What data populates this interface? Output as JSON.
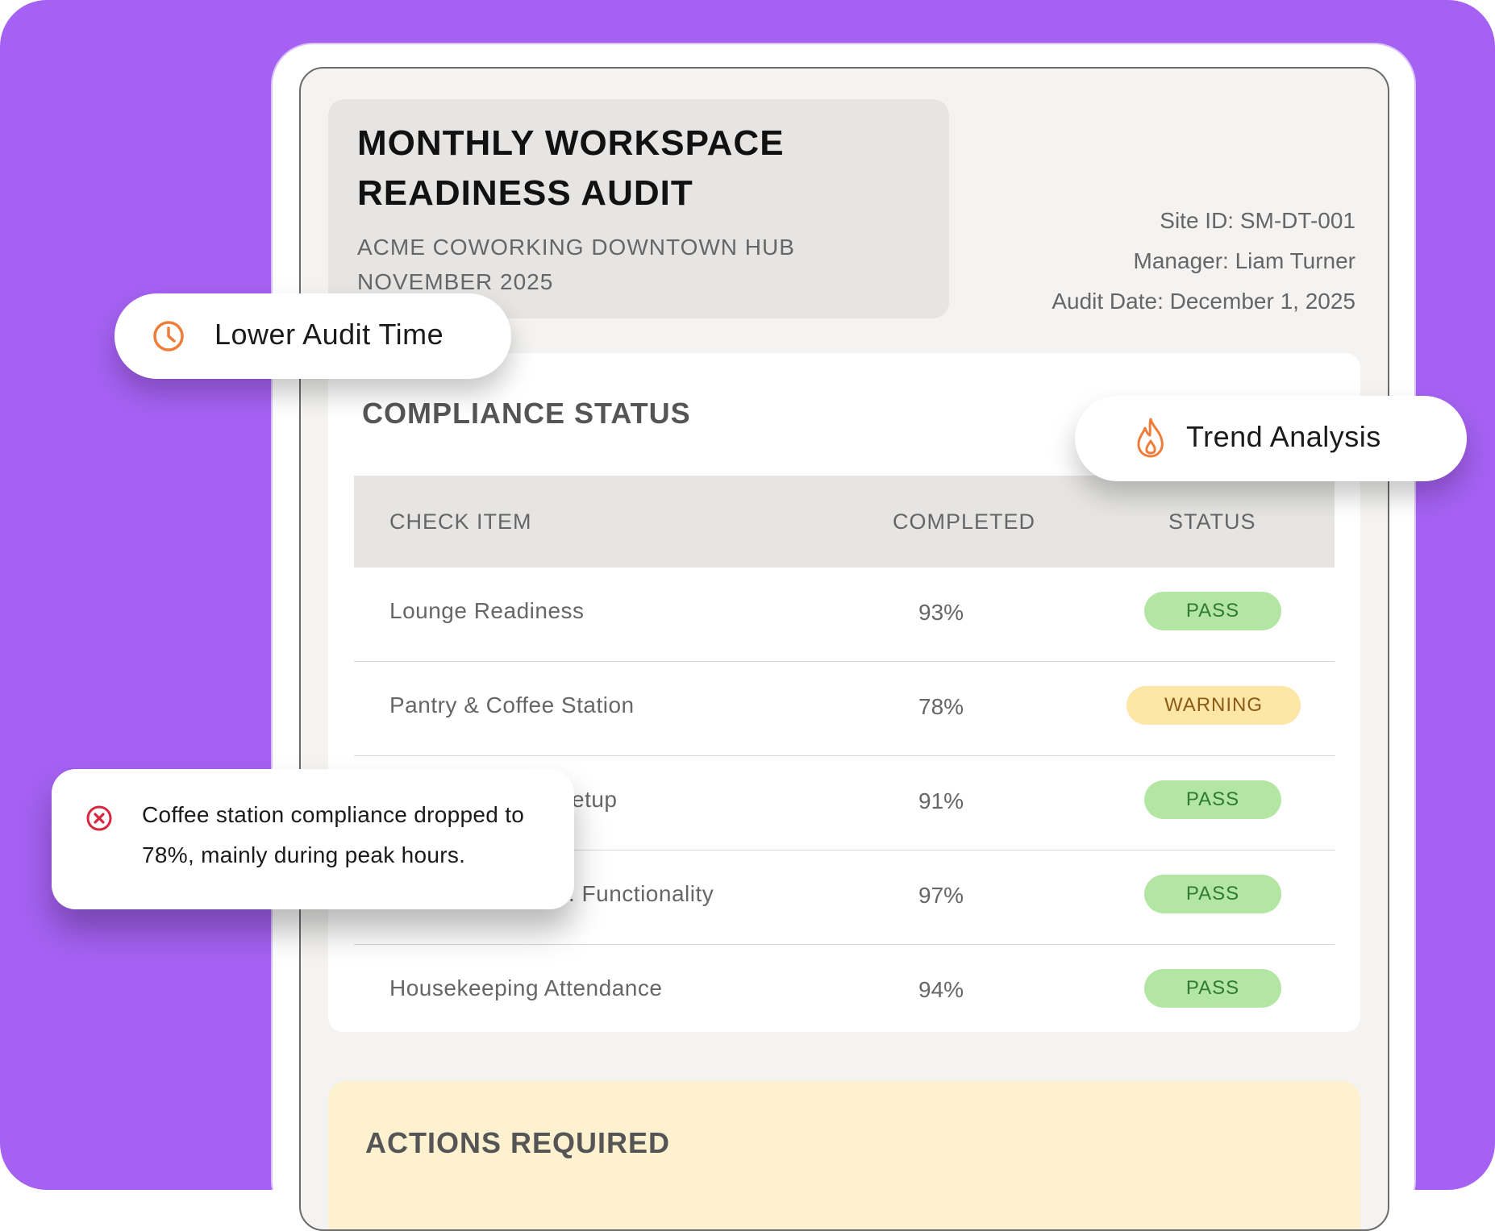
{
  "report": {
    "title": "MONTHLY WORKSPACE READINESS AUDIT",
    "subtitle_line1": "ACME COWORKING DOWNTOWN HUB",
    "subtitle_line2": "NOVEMBER 2025",
    "site_id": "Site ID: SM-DT-001",
    "manager": "Manager: Liam Turner",
    "audit_date": "Audit Date: December 1, 2025"
  },
  "compliance": {
    "section_title": "COMPLIANCE STATUS",
    "columns": {
      "item": "CHECK ITEM",
      "completed": "COMPLETED",
      "status": "STATUS"
    },
    "rows": [
      {
        "item": "Lounge Readiness",
        "completed": "93%",
        "status": "PASS"
      },
      {
        "item": "Pantry & Coffee Station",
        "completed": "78%",
        "status": "WARNING"
      },
      {
        "item": "etup",
        "completed": "91%",
        "status": "PASS"
      },
      {
        "item": ". Functionality",
        "completed": "97%",
        "status": "PASS"
      },
      {
        "item": "Housekeeping Attendance",
        "completed": "94%",
        "status": "PASS"
      }
    ]
  },
  "actions": {
    "section_title": "ACTIONS REQUIRED"
  },
  "callouts": {
    "lower_audit_time": "Lower Audit Time",
    "trend_analysis": "Trend Analysis",
    "alert_message": "Coffee station compliance dropped to 78%, mainly during peak hours."
  },
  "icons": {
    "clock": "clock-icon",
    "flame": "flame-icon",
    "error": "error-circle-icon"
  },
  "colors": {
    "background": "#a561f2",
    "pass_badge": "#b2e6a2",
    "pass_text": "#2f7a37",
    "warning_badge": "#fde6a6",
    "warning_text": "#8a5a16",
    "actions_card": "#fdf1cf",
    "icon_orange": "#ee7d3a",
    "error_red": "#d7263d"
  }
}
